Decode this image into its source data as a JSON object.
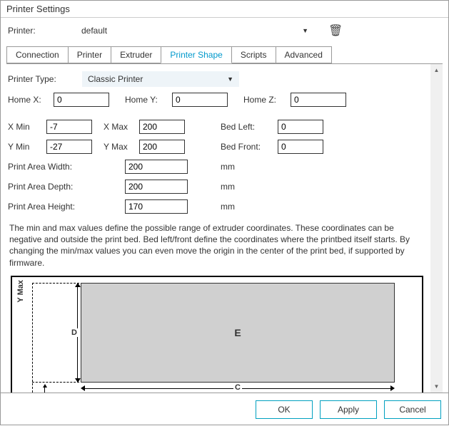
{
  "window_title": "Printer Settings",
  "printer_label": "Printer:",
  "printer_value": "default",
  "tabs": [
    "Connection",
    "Printer",
    "Extruder",
    "Printer Shape",
    "Scripts",
    "Advanced"
  ],
  "active_tab": "Printer Shape",
  "printer_type_label": "Printer Type:",
  "printer_type_value": "Classic Printer",
  "home_x_label": "Home X:",
  "home_x_value": "0",
  "home_y_label": "Home Y:",
  "home_y_value": "0",
  "home_z_label": "Home Z:",
  "home_z_value": "0",
  "xmin_label": "X Min",
  "xmin_value": "-7",
  "xmax_label": "X Max",
  "xmax_value": "200",
  "ymin_label": "Y Min",
  "ymin_value": "-27",
  "ymax_label": "Y Max",
  "ymax_value": "200",
  "bedleft_label": "Bed Left:",
  "bedleft_value": "0",
  "bedfront_label": "Bed Front:",
  "bedfront_value": "0",
  "paw_label": "Print Area Width:",
  "paw_value": "200",
  "pad_label": "Print Area Depth:",
  "pad_value": "200",
  "pah_label": "Print Area Height:",
  "pah_value": "170",
  "unit": "mm",
  "help_text": "The min and max values define the possible range of extruder coordinates. These coordinates can be negative and outside the print bed. Bed left/front define the coordinates where the printbed itself starts. By changing the min/max values you can even move the origin in the center of the print bed, if supported by firmware.",
  "diagram": {
    "y_axis": "Y Max",
    "d": "D",
    "c": "C",
    "e": "E"
  },
  "buttons": {
    "ok": "OK",
    "apply": "Apply",
    "cancel": "Cancel"
  }
}
